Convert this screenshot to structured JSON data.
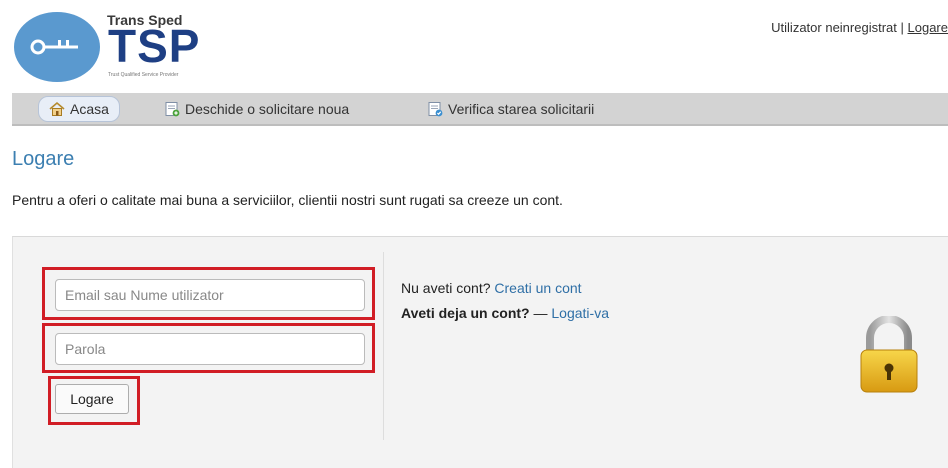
{
  "brand": {
    "name": "Trans Sped",
    "mark": "TSP",
    "tagline": "Trust Qualified Service Provider"
  },
  "header": {
    "user_status": "Utilizator neinregistrat",
    "separator": "|",
    "login_link": "Logare"
  },
  "nav": {
    "items": [
      {
        "label": "Acasa",
        "icon": "home-icon"
      },
      {
        "label": "Deschide o solicitare noua",
        "icon": "new-ticket-icon"
      },
      {
        "label": "Verifica starea solicitarii",
        "icon": "ticket-status-icon"
      }
    ]
  },
  "page": {
    "title": "Logare",
    "intro": "Pentru a oferi o calitate mai buna a serviciilor, clientii nostri sunt rugati sa creeze un cont."
  },
  "login_form": {
    "username_placeholder": "Email sau Nume utilizator",
    "username_value": "",
    "password_placeholder": "Parola",
    "password_value": "",
    "submit_label": "Logare"
  },
  "account_info": {
    "no_account_text": "Nu aveti cont?",
    "create_account_link": "Creati un cont",
    "has_account_text": "Aveti deja un cont?",
    "dash": "—",
    "signin_link": "Logati-va"
  },
  "colors": {
    "accent": "#3c7fb1",
    "brand_blue": "#1e3f84",
    "logo_circle": "#5a99cf",
    "highlight": "#d11d25",
    "padlock": "#e6b625"
  },
  "icons": {
    "lock": "padlock-icon",
    "key": "key-icon"
  }
}
